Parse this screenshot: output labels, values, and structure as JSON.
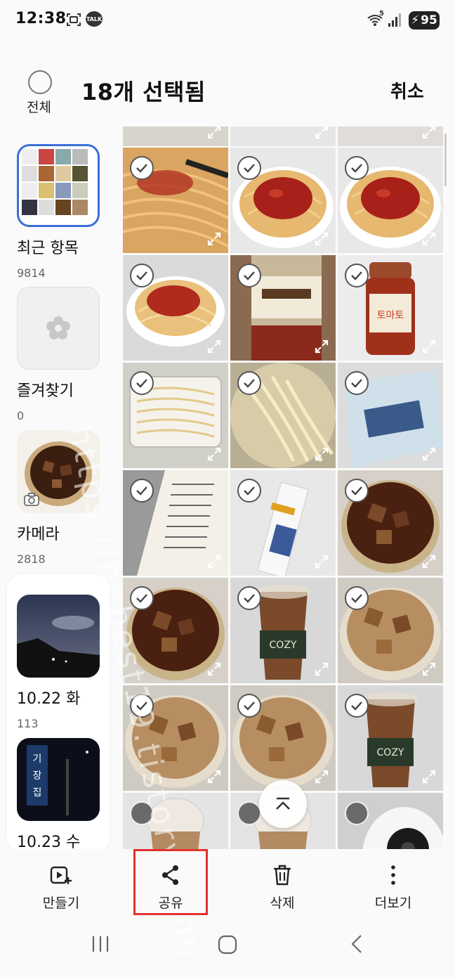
{
  "status_bar": {
    "time": "12:38",
    "talk_badge": "TALK",
    "wifi_badge": "5",
    "battery_level": "95"
  },
  "header": {
    "select_all_label": "전체",
    "title": "18개 선택됨",
    "cancel_label": "취소"
  },
  "albums": [
    {
      "name": "최근 항목",
      "count": "9814"
    },
    {
      "name": "즐겨찾기",
      "count": "0"
    },
    {
      "name": "카메라",
      "count": "2818"
    }
  ],
  "date_groups": [
    {
      "label": "10.22 화",
      "count": "113"
    },
    {
      "label": "10.23 수",
      "sign_text": "기장 집"
    }
  ],
  "grid": {
    "photos": [
      {
        "subject": "spaghetti-close",
        "selected": true
      },
      {
        "subject": "spaghetti-sauce",
        "selected": true
      },
      {
        "subject": "spaghetti-sauce",
        "selected": true
      },
      {
        "subject": "spaghetti-bowl",
        "selected": true
      },
      {
        "subject": "sauce-jar",
        "selected": true
      },
      {
        "subject": "tomato-jar",
        "selected": true
      },
      {
        "subject": "noodles-container",
        "selected": true
      },
      {
        "subject": "noodles-cooking",
        "selected": true
      },
      {
        "subject": "pasta-bag",
        "selected": true
      },
      {
        "subject": "package-label",
        "selected": true
      },
      {
        "subject": "spaghetti-packet",
        "selected": true
      },
      {
        "subject": "iced-coffee",
        "selected": true
      },
      {
        "subject": "iced-coffee",
        "selected": true
      },
      {
        "subject": "iced-latte-cup",
        "selected": true
      },
      {
        "subject": "iced-latte",
        "selected": true
      },
      {
        "subject": "iced-latte",
        "selected": true
      },
      {
        "subject": "iced-latte",
        "selected": true
      },
      {
        "subject": "iced-latte-cup",
        "selected": true
      },
      {
        "subject": "latte-cup",
        "selected": false
      },
      {
        "subject": "latte-cup",
        "selected": false
      },
      {
        "subject": "white-device",
        "selected": false
      }
    ]
  },
  "watermark": "https://bebest19.tistory.com/",
  "action_bar": [
    {
      "label": "만들기",
      "icon": "create-icon"
    },
    {
      "label": "공유",
      "icon": "share-icon"
    },
    {
      "label": "삭제",
      "icon": "delete-icon"
    },
    {
      "label": "더보기",
      "icon": "more-icon"
    }
  ],
  "colors": {
    "highlight": "#e53030",
    "selected_border": "#3a6fd8"
  }
}
